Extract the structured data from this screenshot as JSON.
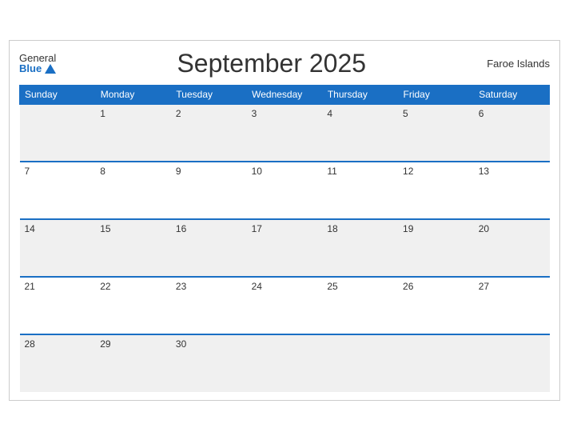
{
  "header": {
    "logo_general": "General",
    "logo_blue": "Blue",
    "title": "September 2025",
    "region": "Faroe Islands"
  },
  "weekdays": [
    "Sunday",
    "Monday",
    "Tuesday",
    "Wednesday",
    "Thursday",
    "Friday",
    "Saturday"
  ],
  "weeks": [
    [
      "",
      "1",
      "2",
      "3",
      "4",
      "5",
      "6"
    ],
    [
      "7",
      "8",
      "9",
      "10",
      "11",
      "12",
      "13"
    ],
    [
      "14",
      "15",
      "16",
      "17",
      "18",
      "19",
      "20"
    ],
    [
      "21",
      "22",
      "23",
      "24",
      "25",
      "26",
      "27"
    ],
    [
      "28",
      "29",
      "30",
      "",
      "",
      "",
      ""
    ]
  ]
}
